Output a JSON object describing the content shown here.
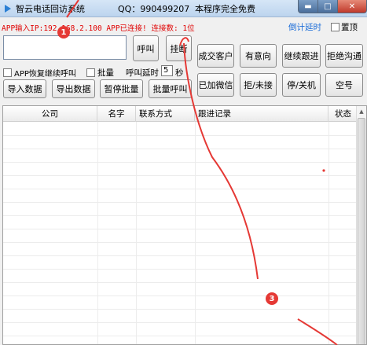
{
  "titlebar": {
    "title": "智云电话回访系统",
    "qq": "QQ：990499207",
    "free_notice": "本程序完全免费",
    "minimize_glyph": "▬",
    "maximize_glyph": "□",
    "close_glyph": "✕"
  },
  "status": {
    "line": "APP输入IP:192.168.2.100 APP已连接! 连接数: 1位",
    "countdown_label": "倒计延时",
    "pin_label": "置顶"
  },
  "dialer": {
    "phone_value": "",
    "call_button": "呼叫",
    "hangup_button": "挂断"
  },
  "status_buttons": {
    "row1": [
      "成交客户",
      "有意向",
      "继续跟进",
      "拒绝沟通"
    ],
    "row2": [
      "已加微信",
      "拒/未接",
      "停/关机",
      "空号"
    ]
  },
  "options": {
    "resume_label": "APP恢复继续呼叫",
    "batch_label": "批量",
    "delay_label": "呼叫延时",
    "delay_value": "5",
    "delay_unit": "秒"
  },
  "actions": [
    "导入数据",
    "导出数据",
    "暂停批量",
    "批量呼叫"
  ],
  "table": {
    "columns": [
      "公司",
      "名字",
      "联系方式",
      "跟进记录",
      "状态"
    ],
    "rows": []
  },
  "annotations": {
    "markers": [
      "1",
      "3"
    ],
    "color": "#e53935"
  },
  "colors": {
    "status_red": "#e00000",
    "link_blue": "#1a6cd8"
  }
}
